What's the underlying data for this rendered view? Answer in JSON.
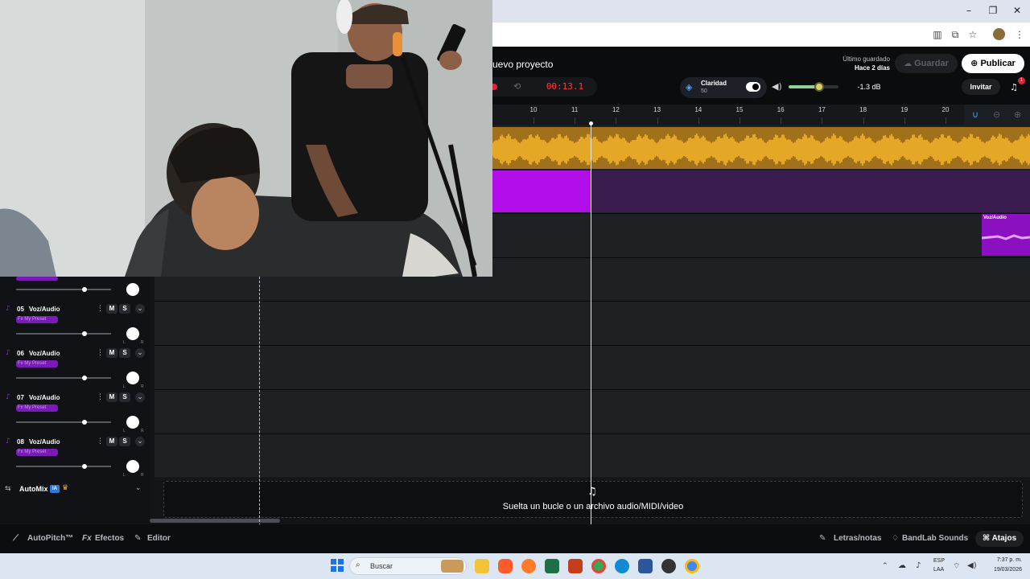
{
  "window": {
    "minimize_icon": "minimize-icon",
    "restore_icon": "restore-icon",
    "close_icon": "close-icon"
  },
  "header": {
    "project_title": "uevo proyecto",
    "last_saved_label": "Último guardado",
    "last_saved_value": "Hace 2 días",
    "save_label": "Guardar",
    "publish_label": "Publicar",
    "invite_label": "Invitar",
    "notification_count": "1"
  },
  "transport": {
    "time": "00:13.1",
    "clarity_label": "Claridad",
    "clarity_value": "50",
    "volume_db": "-1.3 dB",
    "volume_level": 0.62
  },
  "ruler": {
    "bars": [
      "10",
      "11",
      "12",
      "13",
      "14",
      "15",
      "16",
      "17",
      "18",
      "19",
      "20"
    ]
  },
  "clips": {
    "voz_clip_label": "Voz/Audio"
  },
  "tracks": [
    {
      "number": "05",
      "name": "Voz/Audio",
      "fx": "Fx My Preset",
      "mute": "M",
      "solo": "S"
    },
    {
      "number": "06",
      "name": "Voz/Audio",
      "fx": "Fx My Preset",
      "mute": "M",
      "solo": "S"
    },
    {
      "number": "07",
      "name": "Voz/Audio",
      "fx": "Fx My Preset",
      "mute": "M",
      "solo": "S"
    },
    {
      "number": "08",
      "name": "Voz/Audio",
      "fx": "Fx My Preset",
      "mute": "M",
      "solo": "S"
    }
  ],
  "pan": {
    "left": "L",
    "right": "R"
  },
  "automix": {
    "label": "AutoMix",
    "badge": "IA"
  },
  "drop_zone": {
    "text": "Suelta un bucle o un archivo audio/MIDI/video"
  },
  "bottom_bar": {
    "autopitch": "AutoPitch™",
    "effects": "Efectos",
    "editor": "Editor",
    "lyrics": "Letras/notas",
    "sounds": "BandLab Sounds",
    "shortcuts": "Atajos"
  },
  "taskbar": {
    "search_placeholder": "Buscar",
    "lang_1": "ESP",
    "lang_2": "LAA",
    "time": "7:37 p. m.",
    "date": "19/03/2026"
  },
  "colors": {
    "accent_purple": "#b10eea",
    "waveform_yellow": "#f5b52a",
    "time_red": "#ff3b3b"
  }
}
